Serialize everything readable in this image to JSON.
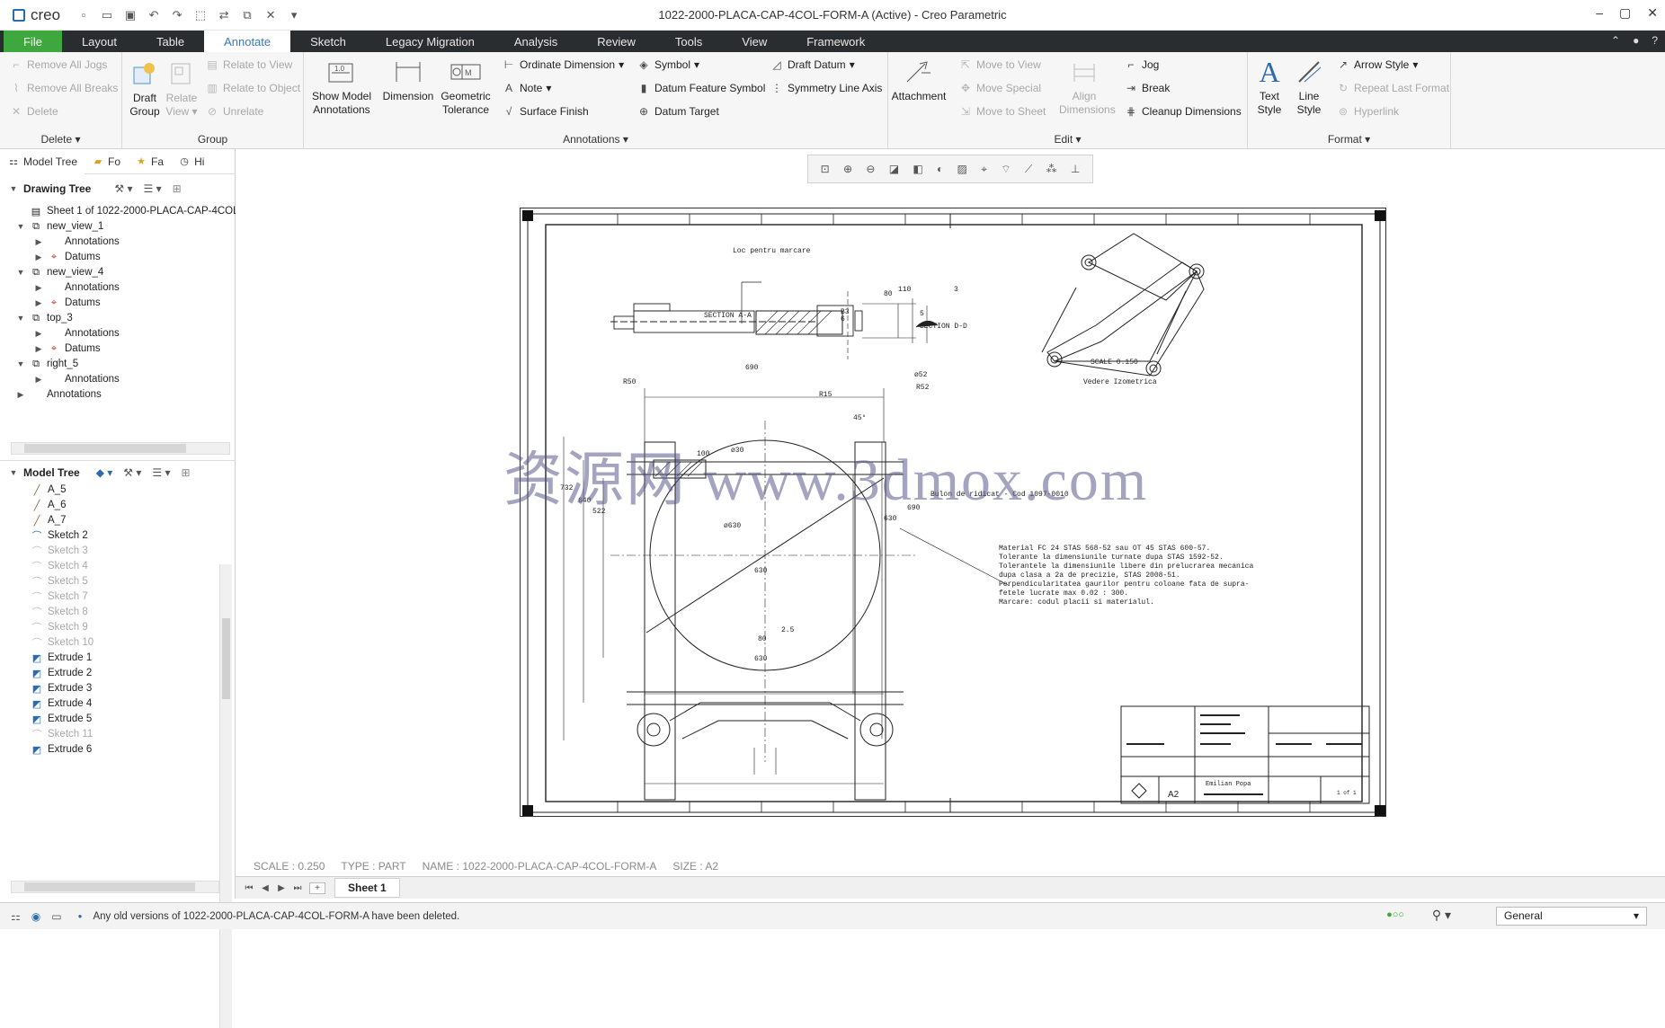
{
  "window": {
    "title": "1022-2000-PLACA-CAP-4COL-FORM-A (Active) - Creo Parametric",
    "logo": "creo"
  },
  "menu": {
    "tabs": [
      "File",
      "Layout",
      "Table",
      "Annotate",
      "Sketch",
      "Legacy Migration",
      "Analysis",
      "Review",
      "Tools",
      "View",
      "Framework"
    ],
    "active": "Annotate"
  },
  "ribbon": {
    "delete_group": {
      "label": "Delete",
      "items": [
        "Remove All Jogs",
        "Remove All Breaks",
        "Delete"
      ]
    },
    "group_group": {
      "label": "Group",
      "draft_group": "Draft Group",
      "relate_view": "Relate View",
      "items": [
        "Relate to View",
        "Relate to Object",
        "Unrelate"
      ]
    },
    "annotations_group": {
      "label": "Annotations",
      "show_model": "Show Model Annotations",
      "dimension": "Dimension",
      "geom_tol": "Geometric Tolerance",
      "col1": [
        "Ordinate Dimension",
        "Note",
        "Surface Finish"
      ],
      "col2": [
        "Symbol",
        "Datum Feature Symbol",
        "Datum Target"
      ],
      "col3": [
        "Draft Datum",
        "Symmetry Line Axis"
      ]
    },
    "edit_group": {
      "label": "Edit",
      "attachment": "Attachment",
      "items": [
        "Move to View",
        "Move Special",
        "Move to Sheet"
      ],
      "align": "Align Dimensions",
      "items2": [
        "Jog",
        "Break",
        "Cleanup Dimensions"
      ]
    },
    "format_group": {
      "label": "Format",
      "text_style": "Text Style",
      "line_style": "Line Style",
      "items": [
        "Arrow Style",
        "Repeat Last Format",
        "Hyperlink"
      ]
    }
  },
  "panel": {
    "tabs": [
      "Model Tree",
      "Fo",
      "Fa",
      "Hi"
    ],
    "drawing_tree_title": "Drawing Tree",
    "drawing_tree": [
      {
        "label": "Sheet 1 of 1022-2000-PLACA-CAP-4COL-FO",
        "lvl": 0
      },
      {
        "label": "new_view_1",
        "lvl": 0
      },
      {
        "label": "Annotations",
        "lvl": 1
      },
      {
        "label": "Datums",
        "lvl": 1
      },
      {
        "label": "new_view_4",
        "lvl": 0
      },
      {
        "label": "Annotations",
        "lvl": 1
      },
      {
        "label": "Datums",
        "lvl": 1
      },
      {
        "label": "top_3",
        "lvl": 0
      },
      {
        "label": "Annotations",
        "lvl": 1
      },
      {
        "label": "Datums",
        "lvl": 1
      },
      {
        "label": "right_5",
        "lvl": 0
      },
      {
        "label": "Annotations",
        "lvl": 1
      },
      {
        "label": "Annotations",
        "lvl": -1
      }
    ],
    "model_tree_title": "Model Tree",
    "model_tree": [
      "A_5",
      "A_6",
      "A_7",
      "Sketch 2",
      "Sketch 3",
      "Sketch 4",
      "Sketch 5",
      "Sketch 7",
      "Sketch 8",
      "Sketch 9",
      "Sketch 10",
      "Extrude 1",
      "Extrude 2",
      "Extrude 3",
      "Extrude 4",
      "Extrude 5",
      "Sketch 11",
      "Extrude 6"
    ]
  },
  "drawing": {
    "section_aa": "SECTION A-A",
    "section_dd": "SECTION D-D",
    "loc_label": "Loc pentru marcare",
    "bolt_label": "Bulon de ridicat - Cod 1097-0010",
    "scale_iso": "SCALE 0.150",
    "iso_label": "Vedere Izometrica",
    "dims": [
      "690",
      "ø52",
      "R52",
      "R15",
      "45°",
      "ø30",
      "100",
      "732",
      "640",
      "522",
      "ø630",
      "630",
      "630",
      "690",
      "2.5",
      "80",
      "630",
      "R50",
      "110",
      "80",
      "B3",
      "6",
      "3",
      "5"
    ],
    "notes": [
      "Material FC 24 STAS 568-52 sau OT 45 STAS 600-57.",
      "Tolerante la dimensiunile turnate dupa STAS 1592-52.",
      "Tolerantele la dimensiunile libere din prelucrarea mecanica",
      "dupa clasa a 2a de precizie, STAS 2008-51.",
      "Perpendicularitatea gaurilor pentru coloane fata de supra-",
      "fetele lucrate max 0.02 : 300.",
      "Marcare: codul placii si materialul."
    ],
    "title_block": {
      "size": "A2",
      "author": "Emilian Popa",
      "sheet": "1 of 1"
    }
  },
  "watermark": "资源网 www.3dmox.com",
  "info": {
    "scale": "SCALE : 0.250",
    "type": "TYPE : PART",
    "name": "NAME : 1022-2000-PLACA-CAP-4COL-FORM-A",
    "size": "SIZE : A2"
  },
  "sheet_tab": "Sheet 1",
  "status": {
    "message": "Any old versions of 1022-2000-PLACA-CAP-4COL-FORM-A have been deleted.",
    "filter": "General"
  }
}
